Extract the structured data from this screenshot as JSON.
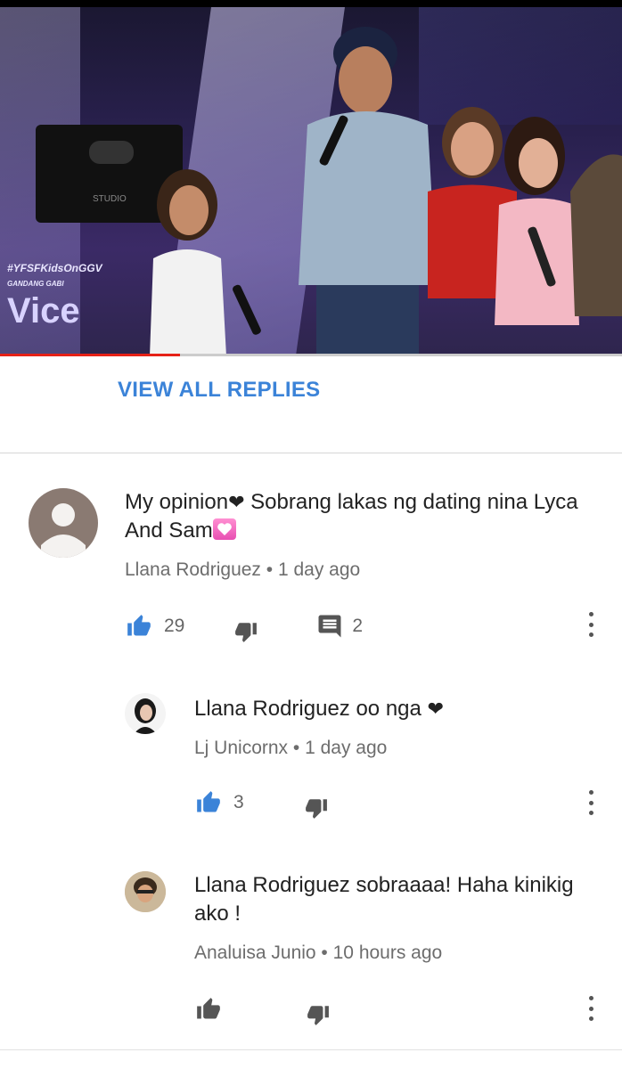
{
  "video": {
    "hashtag": "#YFSFKidsOnGGV",
    "show_small": "GANDANG GABI",
    "show_logo": "Vice",
    "speaker_label": "STUDIO",
    "progress": 0.29
  },
  "replies_toggle": {
    "label": "VIEW ALL REPLIES"
  },
  "comments": [
    {
      "text_before": "My opinion",
      "text_after": " Sobrang lakas ng dating nina Lyca And Sam",
      "author": "Llana Rodriguez",
      "time": "1 day ago",
      "likes": "29",
      "replies": "2",
      "like_active": true
    },
    {
      "text": "Llana Rodriguez oo nga ",
      "author": "Lj Unicornx",
      "time": "1 day ago",
      "likes": "3",
      "like_active": true
    },
    {
      "text": "Llana Rodriguez sobraaaa! Haha kinikig ako !",
      "author": "Analuisa Junio",
      "time": "10 hours ago",
      "likes": "",
      "like_active": false
    }
  ],
  "separator": " • ",
  "colors": {
    "accent_blue": "#3b83d8",
    "progress_red": "#e62117",
    "icon_gray": "#555555"
  }
}
